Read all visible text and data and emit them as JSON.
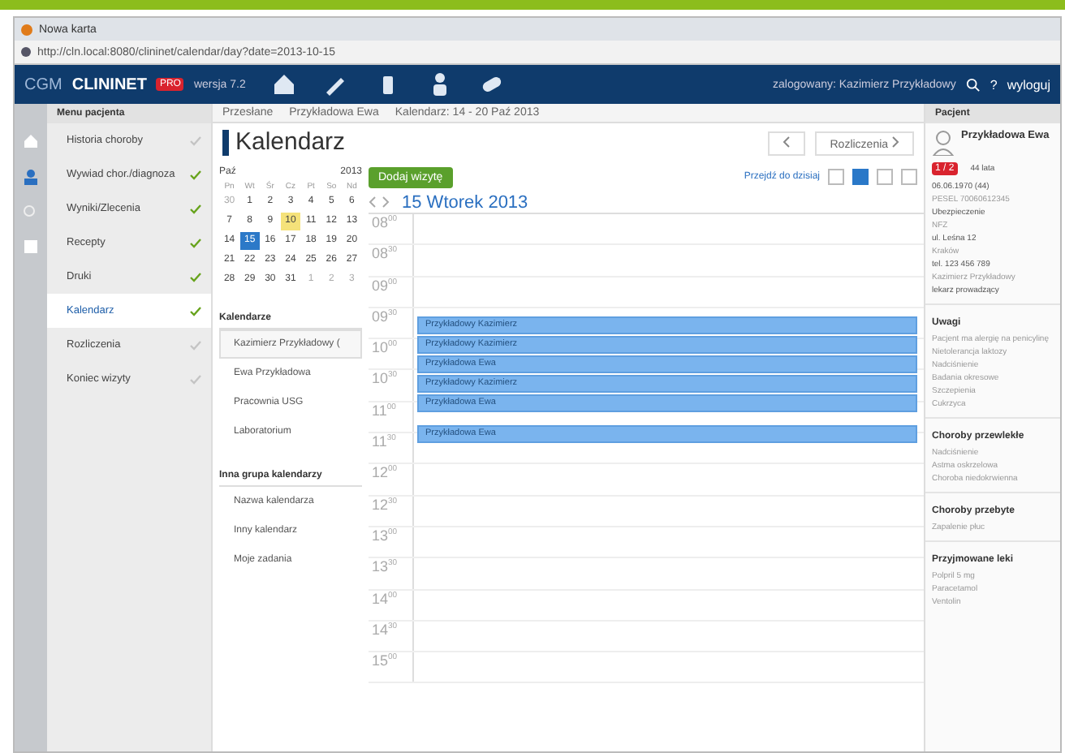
{
  "browser": {
    "tab_title": "Nowa karta",
    "address": "http://cln.local:8080/clininet/calendar/day?date=2013-10-15"
  },
  "app": {
    "logo_prefix": "CGM",
    "logo_name": "CLININET",
    "logo_badge": "PRO",
    "version": "wersja 7.2",
    "user": "zalogowany: Kazimierz Przykładowy",
    "help": "?",
    "logout": "wyloguj"
  },
  "menu": {
    "title": "Menu pacjenta",
    "items": [
      {
        "label": "Historia choroby",
        "done": false,
        "selected": false
      },
      {
        "label": "Wywiad chor./diagnoza",
        "done": true,
        "selected": false
      },
      {
        "label": "Wyniki/Zlecenia",
        "done": true,
        "selected": false
      },
      {
        "label": "Recepty",
        "done": true,
        "selected": false
      },
      {
        "label": "Druki",
        "done": true,
        "selected": false
      },
      {
        "label": "Kalendarz",
        "done": true,
        "selected": true
      },
      {
        "label": "Rozliczenia",
        "done": false,
        "selected": false
      },
      {
        "label": "Koniec wizyty",
        "done": false,
        "selected": false
      }
    ]
  },
  "breadcrumb": [
    "Przesłane",
    "Przykładowa Ewa",
    "Kalendarz: 14 - 20 Paź 2013"
  ],
  "page_title": "Kalendarz",
  "next_link": "Rozliczenia",
  "mini_calendar": {
    "month": "Paź",
    "year": "2013",
    "weekdays": [
      "Pn",
      "Wt",
      "Śr",
      "Cz",
      "Pt",
      "So",
      "Nd"
    ],
    "days": [
      {
        "d": "30",
        "other": true,
        "selected": false,
        "today": false
      },
      {
        "d": "1",
        "other": false,
        "selected": false,
        "today": false
      },
      {
        "d": "2",
        "other": false,
        "selected": false,
        "today": false
      },
      {
        "d": "3",
        "other": false,
        "selected": false,
        "today": false
      },
      {
        "d": "4",
        "other": false,
        "selected": false,
        "today": false
      },
      {
        "d": "5",
        "other": false,
        "selected": false,
        "today": false
      },
      {
        "d": "6",
        "other": false,
        "selected": false,
        "today": false
      },
      {
        "d": "7",
        "other": false,
        "selected": false,
        "today": false
      },
      {
        "d": "8",
        "other": false,
        "selected": false,
        "today": false
      },
      {
        "d": "9",
        "other": false,
        "selected": false,
        "today": false
      },
      {
        "d": "10",
        "other": false,
        "selected": false,
        "today": true
      },
      {
        "d": "11",
        "other": false,
        "selected": false,
        "today": false
      },
      {
        "d": "12",
        "other": false,
        "selected": false,
        "today": false
      },
      {
        "d": "13",
        "other": false,
        "selected": false,
        "today": false
      },
      {
        "d": "14",
        "other": false,
        "selected": false,
        "today": false
      },
      {
        "d": "15",
        "other": false,
        "selected": true,
        "today": false
      },
      {
        "d": "16",
        "other": false,
        "selected": false,
        "today": false
      },
      {
        "d": "17",
        "other": false,
        "selected": false,
        "today": false
      },
      {
        "d": "18",
        "other": false,
        "selected": false,
        "today": false
      },
      {
        "d": "19",
        "other": false,
        "selected": false,
        "today": false
      },
      {
        "d": "20",
        "other": false,
        "selected": false,
        "today": false
      },
      {
        "d": "21",
        "other": false,
        "selected": false,
        "today": false
      },
      {
        "d": "22",
        "other": false,
        "selected": false,
        "today": false
      },
      {
        "d": "23",
        "other": false,
        "selected": false,
        "today": false
      },
      {
        "d": "24",
        "other": false,
        "selected": false,
        "today": false
      },
      {
        "d": "25",
        "other": false,
        "selected": false,
        "today": false
      },
      {
        "d": "26",
        "other": false,
        "selected": false,
        "today": false
      },
      {
        "d": "27",
        "other": false,
        "selected": false,
        "today": false
      },
      {
        "d": "28",
        "other": false,
        "selected": false,
        "today": false
      },
      {
        "d": "29",
        "other": false,
        "selected": false,
        "today": false
      },
      {
        "d": "30",
        "other": false,
        "selected": false,
        "today": false
      },
      {
        "d": "31",
        "other": false,
        "selected": false,
        "today": false
      },
      {
        "d": "1",
        "other": true,
        "selected": false,
        "today": false
      },
      {
        "d": "2",
        "other": true,
        "selected": false,
        "today": false
      },
      {
        "d": "3",
        "other": true,
        "selected": false,
        "today": false
      }
    ]
  },
  "calendar_groups": [
    {
      "title": "Kalendarze",
      "items": [
        {
          "label": "Kazimierz Przykładowy (",
          "selected": true
        },
        {
          "label": "Ewa Przykładowa",
          "selected": false
        },
        {
          "label": "Pracownia USG",
          "selected": false
        },
        {
          "label": "Laboratorium",
          "selected": false
        }
      ]
    },
    {
      "title": "Inna grupa kalendarzy",
      "items": [
        {
          "label": "Nazwa kalendarza",
          "selected": false
        },
        {
          "label": "Inny kalendarz",
          "selected": false
        },
        {
          "label": "Moje zadania",
          "selected": false
        }
      ]
    }
  ],
  "add_button": "Dodaj wizytę",
  "today_link": "Przejdź do dzisiaj",
  "views": [
    {
      "selected": false
    },
    {
      "selected": true
    },
    {
      "selected": false
    },
    {
      "selected": false
    }
  ],
  "day_title": "15 Wtorek 2013",
  "slots": [
    "08$^{00}$",
    "08$^{30}$",
    "09$^{00}$",
    "09$^{30}$",
    "10$^{00}$",
    "10$^{30}$",
    "11$^{00}$",
    "11$^{30}$",
    "12$^{00}$",
    "12$^{30}$",
    "13$^{00}$",
    "13$^{30}$",
    "14$^{00}$",
    "14$^{30}$",
    "15$^{00}$"
  ],
  "event_blocks": [
    {
      "entries": [
        "Przykładowy Kazimierz",
        "Przykładowy Kazimierz",
        "Przykładowa Ewa",
        "Przykładowy Kazimierz",
        "Przykładowa Ewa"
      ]
    },
    {
      "entries": [
        "Przykładowa Ewa"
      ]
    }
  ],
  "patient": {
    "title": "Pacjent",
    "name": "Przykładowa Ewa",
    "badge": "1 / 2",
    "age": "44 lata",
    "details": [
      "06.06.1970 (44)",
      "PESEL 70060612345",
      "Ubezpieczenie",
      "NFZ",
      "ul. Leśna 12",
      "Kraków",
      "tel. 123 456 789",
      "Kazimierz Przykładowy",
      "lekarz prowadzący"
    ]
  },
  "sections": [
    {
      "title": "Uwagi",
      "items": [
        "Pacjent ma alergię na penicylinę",
        "Nietolerancja laktozy",
        "Nadciśnienie",
        "Badania okresowe",
        "Szczepienia",
        "Cukrzyca"
      ]
    },
    {
      "title": "Choroby przewlekłe",
      "items": [
        "Nadciśnienie",
        "Astma oskrzelowa",
        "Choroba niedokrwienna"
      ]
    },
    {
      "title": "Choroby przebyte",
      "items": [
        "Zapalenie płuc"
      ]
    },
    {
      "title": "Przyjmowane leki",
      "items": [
        "Polpril 5 mg",
        "Paracetamol",
        "Ventolin"
      ]
    }
  ]
}
